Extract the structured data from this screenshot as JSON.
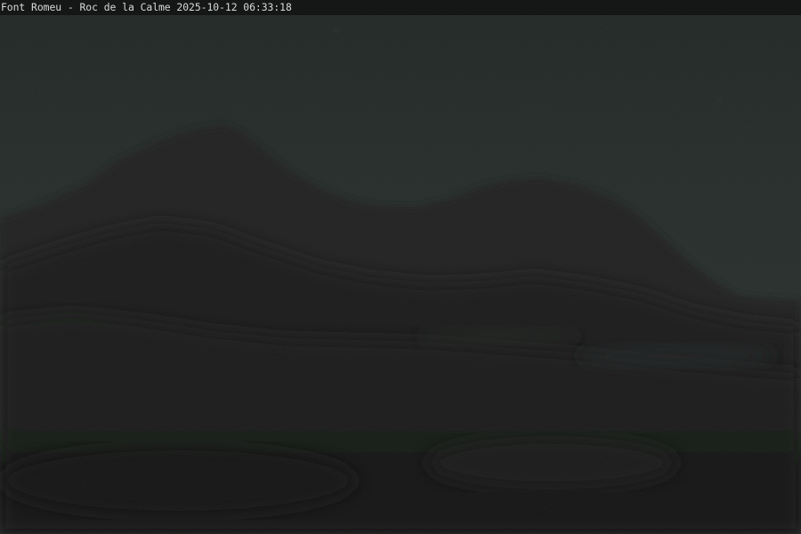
{
  "caption": {
    "text": "Font Romeu - Roc de la Calme 2025-10-12 06:33:18"
  },
  "colors": {
    "sky_top": "#222826",
    "sky_bottom": "#2a3330",
    "mountain_far": "#202322",
    "mountain_near": "#1c1e1d",
    "foreground": "#171817",
    "caption_bar": "#141716",
    "caption_text": "#d9d9d9"
  }
}
